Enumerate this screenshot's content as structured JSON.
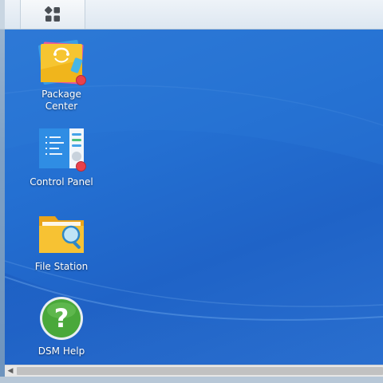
{
  "taskbar": {
    "main_menu_icon": "four-squares-icon"
  },
  "desktop": {
    "icons": [
      {
        "label": "Package\nCenter",
        "icon": "package-center-icon",
        "has_badge": true
      },
      {
        "label": "Control Panel",
        "icon": "control-panel-icon",
        "has_badge": true
      },
      {
        "label": "File Station",
        "icon": "file-station-icon",
        "has_badge": false
      },
      {
        "label": "DSM Help",
        "icon": "help-icon",
        "has_badge": false
      }
    ]
  },
  "scrollbar": {
    "left_arrow": "◀"
  },
  "colors": {
    "desktop_bg": "#2470d2",
    "badge": "#e8414c",
    "taskbar": "#dde7f1"
  }
}
